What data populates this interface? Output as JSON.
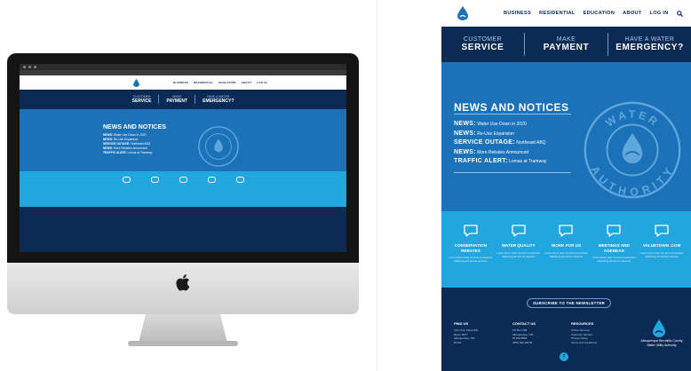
{
  "nav": {
    "links": [
      "BUSINESS",
      "RESIDENTIAL",
      "EDUCATION",
      "ABOUT",
      "LOG IN"
    ]
  },
  "cta": [
    {
      "small": "CUSTOMER",
      "big": "SERVICE"
    },
    {
      "small": "MAKE",
      "big": "PAYMENT"
    },
    {
      "small": "HAVE A WATER",
      "big": "EMERGENCY?"
    }
  ],
  "hero": {
    "title": "NEWS AND NOTICES",
    "news": [
      {
        "key": "NEWS:",
        "text": "Water Use Down in 2020"
      },
      {
        "key": "NEWS:",
        "text": "Re-Use Expansion"
      },
      {
        "key": "SERVICE OUTAGE:",
        "text": "Northeast ABQ"
      },
      {
        "key": "NEWS:",
        "text": "More Rebates Announced"
      },
      {
        "key": "TRAFFIC ALERT:",
        "text": "Lomas at Tramway"
      }
    ],
    "badge_top": "WATER",
    "badge_bottom": "AUTHORITY"
  },
  "icons": [
    {
      "title": "CONSERVATION REBATES",
      "desc": "Lorem ipsum dolor sit amet consectetur adipiscing elit sed do eiusmod"
    },
    {
      "title": "WATER QUALITY",
      "desc": "Lorem ipsum dolor sit amet consectetur adipiscing elit sed do eiusmod"
    },
    {
      "title": "WORK FOR US",
      "desc": "Lorem ipsum dolor sit amet consectetur adipiscing elit sed do eiusmod"
    },
    {
      "title": "MEETINGS AND AGENDAS",
      "desc": "Lorem ipsum dolor sit amet consectetur adipiscing elit sed do eiusmod"
    },
    {
      "title": "VALUETOWN .COM",
      "desc": "Lorem ipsum dolor sit amet consectetur adipiscing elit sed do eiusmod"
    }
  ],
  "footer": {
    "subscribe": "SUBSCRIBE TO THE NEWSLETTER",
    "cols": [
      {
        "heading": "FIND US",
        "lines": [
          "One Civic Plaza NW",
          "Room 5027",
          "Albuquerque, NM",
          "87102"
        ]
      },
      {
        "heading": "CONTACT US",
        "lines": [
          "PO Box 568",
          "Albuquerque, NM",
          "87103-0568",
          "(505) 842-WATR"
        ]
      },
      {
        "heading": "RESOURCES",
        "lines": [
          "Online Services",
          "Customer Service",
          "Privacy Policy",
          "Terms and Conditions"
        ]
      }
    ],
    "org_name": "Albuquerque Bernalillo County Water Utility Authority",
    "social": "f"
  },
  "colors": {
    "navy": "#0b2b55",
    "blue": "#1b72b8",
    "cyan": "#22a6df"
  }
}
